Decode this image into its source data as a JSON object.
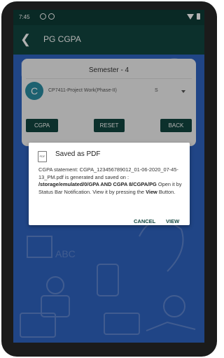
{
  "status_bar": {
    "time": "7:45"
  },
  "app_bar": {
    "title": "PG CGPA"
  },
  "card": {
    "semester": "Semester - 4",
    "avatar_letter": "C",
    "subject": "CP7411-Project Work(Phase-II)",
    "grade": "S",
    "buttons": {
      "cgpa": "CGPA",
      "reset": "RESET",
      "back": "BACK"
    }
  },
  "dialog": {
    "title": "Saved as PDF",
    "message_part1": "CGPA statement: CGPA_123456789012_01-06-2020_07-45-13_PM.pdf is generated and saved on : ",
    "message_path": "/storage/emulated/0/GPA AND CGPA 8/CGPA/PG",
    "message_part2": " Open it by Status Bar Notification. View it by pressing the ",
    "message_view": "View",
    "message_part3": " Button.",
    "cancel_label": "CANCEL",
    "view_label": "VIEW",
    "pdf_icon_text": "PDF"
  },
  "colors": {
    "app_bar": "#12463f",
    "status_bar": "#0e3b35",
    "background": "#2f63c0",
    "accent": "#12463f",
    "avatar": "#2a8ca1"
  },
  "icons": [
    "back-arrow-icon",
    "wifi-icon",
    "battery-icon",
    "pdf-file-icon"
  ]
}
